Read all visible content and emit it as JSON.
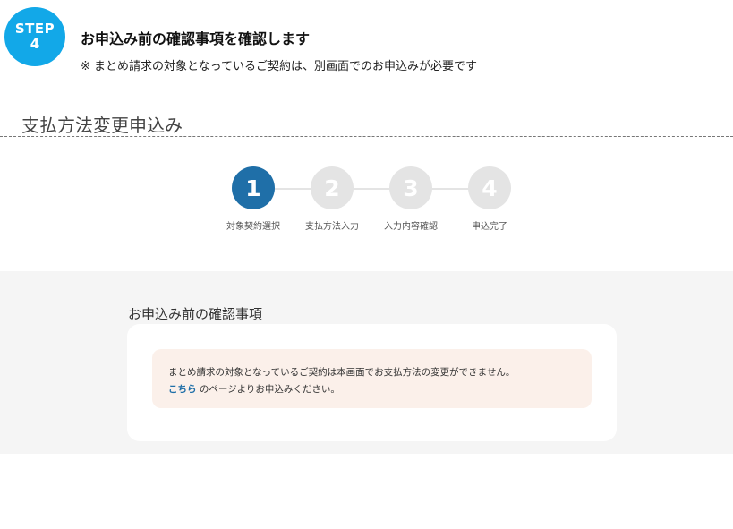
{
  "step": {
    "label": "STEP",
    "number": "4",
    "title": "お申込み前の確認事項を確認します",
    "note": "※ まとめ請求の対象となっているご契約は、別画面でのお申込みが必要です"
  },
  "page": {
    "title": "支払方法変更申込み"
  },
  "stepper": {
    "current": 1,
    "steps": [
      {
        "number": "1",
        "label": "対象契約選択"
      },
      {
        "number": "2",
        "label": "支払方法入力"
      },
      {
        "number": "3",
        "label": "入力内容確認"
      },
      {
        "number": "4",
        "label": "申込完了"
      }
    ]
  },
  "confirmation": {
    "heading": "お申込み前の確認事項",
    "line1": "まとめ請求の対象となっているご契約は本画面でお支払方法の変更ができません。",
    "link_text": "こちら",
    "line2_rest": " のページよりお申込みください。"
  },
  "colors": {
    "badge": "#12a8e8",
    "active_step": "#1f6fa8",
    "inactive_step": "#e4e4e4",
    "notice_bg": "#fbf0ea",
    "band_bg": "#f5f5f5"
  }
}
